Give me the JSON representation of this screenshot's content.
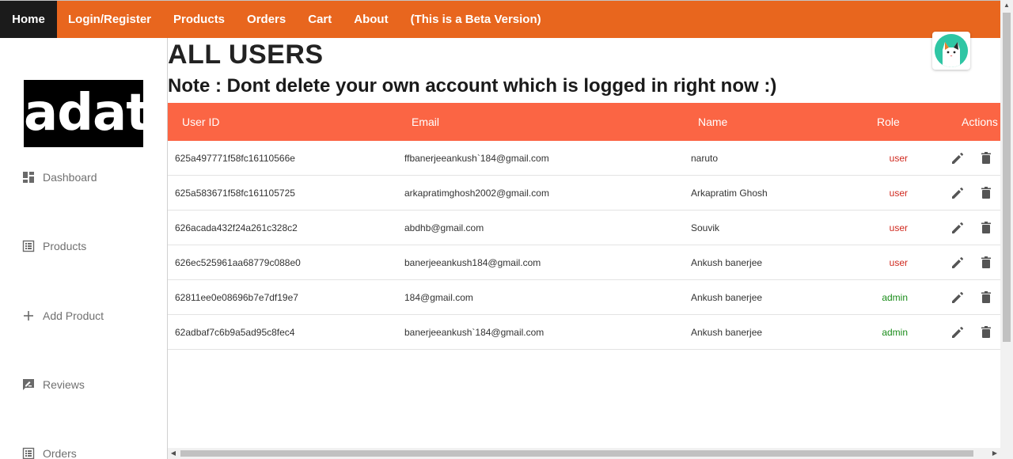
{
  "nav": {
    "items": [
      {
        "label": "Home"
      },
      {
        "label": "Login/Register"
      },
      {
        "label": "Products"
      },
      {
        "label": "Orders"
      },
      {
        "label": "Cart"
      },
      {
        "label": "About"
      },
      {
        "label": "(This is a Beta Version)"
      }
    ],
    "color": "#e8661e",
    "active_color": "#1b1b1b"
  },
  "sidebar": {
    "logo_text": "adat",
    "items": [
      {
        "label": "Dashboard",
        "icon": "dashboard-icon"
      },
      {
        "label": "Products",
        "icon": "list-icon"
      },
      {
        "label": "Add Product",
        "icon": "plus-icon"
      },
      {
        "label": "Reviews",
        "icon": "review-icon"
      },
      {
        "label": "Orders",
        "icon": "list-icon"
      }
    ]
  },
  "main": {
    "title": "ALL USERS",
    "note": "Note : Dont delete your own account which is logged in right now :)"
  },
  "table": {
    "header_color": "#fb6544",
    "columns": [
      "User ID",
      "Email",
      "Name",
      "Role",
      "Actions"
    ],
    "rows": [
      {
        "id": "625a497771f58fc16110566e",
        "email": "ffbanerjeeankush`184@gmail.com",
        "name": "naruto",
        "role": "user"
      },
      {
        "id": "625a583671f58fc161105725",
        "email": "arkapratimghosh2002@gmail.com",
        "name": "Arkapratim Ghosh",
        "role": "user"
      },
      {
        "id": "626acada432f24a261c328c2",
        "email": "abdhb@gmail.com",
        "name": "Souvik",
        "role": "user"
      },
      {
        "id": "626ec525961aa68779c088e0",
        "email": "banerjeeankush184@gmail.com",
        "name": "Ankush banerjee",
        "role": "user"
      },
      {
        "id": "62811ee0e08696b7e7df19e7",
        "email": "184@gmail.com",
        "name": "Ankush banerjee",
        "role": "admin"
      },
      {
        "id": "62adbaf7c6b9a5ad95c8fec4",
        "email": "banerjeeankush`184@gmail.com",
        "name": "Ankush banerjee",
        "role": "admin"
      }
    ],
    "role_colors": {
      "user": "#d0281e",
      "admin": "#1a8c1a"
    }
  }
}
